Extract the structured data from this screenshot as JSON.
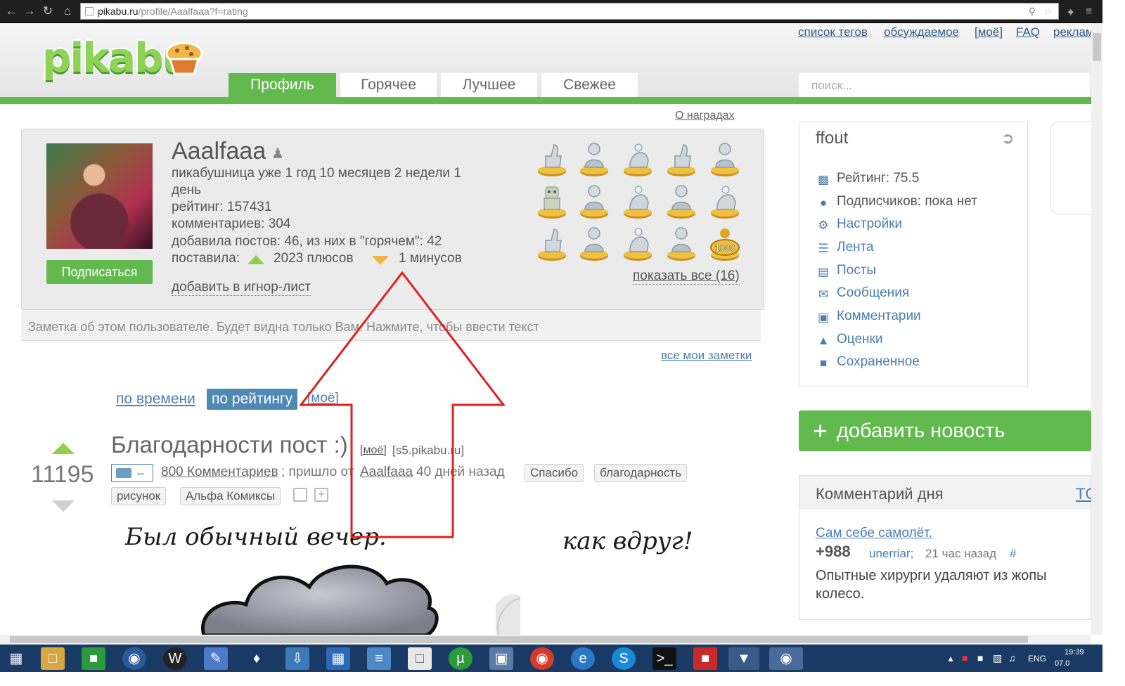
{
  "browser": {
    "url_domain": "pikabu.ru",
    "url_path": "/profile/Aaalfaaa?f=rating"
  },
  "header": {
    "logo": "pikabu",
    "top_links": [
      "список тегов",
      "обсуждаемое",
      "[моё]",
      "FAQ",
      "реклам"
    ],
    "tabs": [
      "Профиль",
      "Горячее",
      "Лучшее",
      "Свежее"
    ],
    "active_tab": "Профиль",
    "search_placeholder": "поиск..."
  },
  "profile": {
    "about_awards": "О наградах",
    "username": "Aaalfaaa",
    "since_line1": "пикабушница уже 1 год 10 месяцев 2 недели 1",
    "since_line2": "день",
    "rating": "рейтинг: 157431",
    "comments": "комментариев: 304",
    "posts": "добавила постов: 46, из них в \"горячем\": 42",
    "gave_label": "поставила:",
    "pluses": "2023 плюсов",
    "minuses": "1 минусов",
    "subscribe": "Подписаться",
    "ignore": "добавить в игнор-лист",
    "show_all": "показать все (16)",
    "award_badge": "1000",
    "note_placeholder": "Заметка об этом пользователе. Будет видна только Вам. Нажмите, чтобы ввести текст",
    "all_notes": "все мои заметки"
  },
  "sort": {
    "by_time": "по времени",
    "by_rating": "по рейтингу",
    "mine": "[моё]"
  },
  "post": {
    "rating": "11195",
    "title": "Благодарности пост :)",
    "mine": "[моё]",
    "source": "[s5.pikabu.ru]",
    "comments": "800 Комментариев",
    "came_from": "; пришло от",
    "author": "Aaalfaaa",
    "ago": "40 дней назад",
    "tags": [
      "Спасибо",
      "благодарность",
      "рисунок",
      "Альфа Комиксы"
    ],
    "comic_text_1": "Был обычный вечер.",
    "comic_text_2": "как вдруг!"
  },
  "sidebar": {
    "username": "ffout",
    "rating": "Рейтинг: 75.5",
    "subscribers": "Подписчиков: пока нет",
    "menu": [
      "Настройки",
      "Лента",
      "Посты",
      "Сообщения",
      "Комментарии",
      "Оценки",
      "Сохраненное"
    ],
    "add_news": "добавить новость",
    "cotd_title": "Комментарий дня",
    "cotd_top": "TC",
    "cotd_post": "Сам себе самолёт.",
    "cotd_score": "+988",
    "cotd_user": "unerriar;",
    "cotd_time": "21 час назад",
    "cotd_hash": "#",
    "cotd_text": "Опытные хирурги удаляют из жопы колесо."
  },
  "taskbar": {
    "lang": "ENG",
    "time": "19:39",
    "date": "07.0"
  },
  "colors": {
    "brand_green": "#62b94d",
    "link_blue": "#4a7eb0",
    "annotation_red": "#e02020"
  }
}
